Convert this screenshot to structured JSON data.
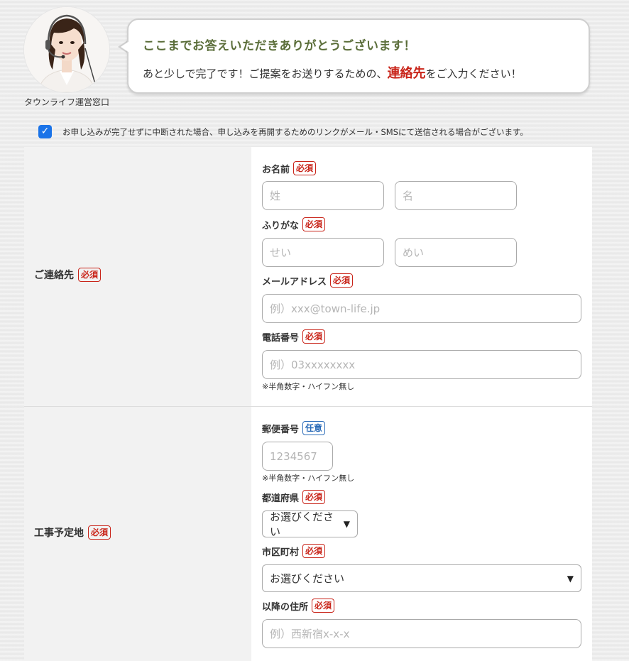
{
  "header": {
    "caption": "タウンライフ運営窓口",
    "title": "ここまでお答えいただきありがとうございます！",
    "subtitle_before": "あと少しで完了です！ご提案をお送りするための、",
    "subtitle_highlight": "連絡先",
    "subtitle_after": "をご入力ください！"
  },
  "consent": {
    "checked_mark": "✓",
    "text": "お申し込みが完了せずに中断された場合、申し込みを再開するためのリンクがメール・SMSにて送信される場合がございます。"
  },
  "badges": {
    "required": "必須",
    "optional": "任意"
  },
  "contact": {
    "label": "ご連絡先",
    "name_label": "お名前",
    "last_name_placeholder": "姓",
    "first_name_placeholder": "名",
    "kana_label": "ふりがな",
    "last_kana_placeholder": "せい",
    "first_kana_placeholder": "めい",
    "email_label": "メールアドレス",
    "email_placeholder": "例）xxx@town-life.jp",
    "phone_label": "電話番号",
    "phone_placeholder": "例）03xxxxxxxx",
    "phone_note": "※半角数字・ハイフン無し"
  },
  "site": {
    "label": "工事予定地",
    "zip_label": "郵便番号",
    "zip_placeholder": "1234567",
    "zip_note": "※半角数字・ハイフン無し",
    "pref_label": "都道府県",
    "pref_value": "お選びください",
    "city_label": "市区町村",
    "city_value": "お選びください",
    "address_label": "以降の住所",
    "address_placeholder": "例）西新宿x-x-x"
  },
  "colors": {
    "accent_red": "#c9251a",
    "accent_blue": "#2a6bb8",
    "title_green": "#5b6e3a",
    "checkbox": "#1a73e8"
  }
}
